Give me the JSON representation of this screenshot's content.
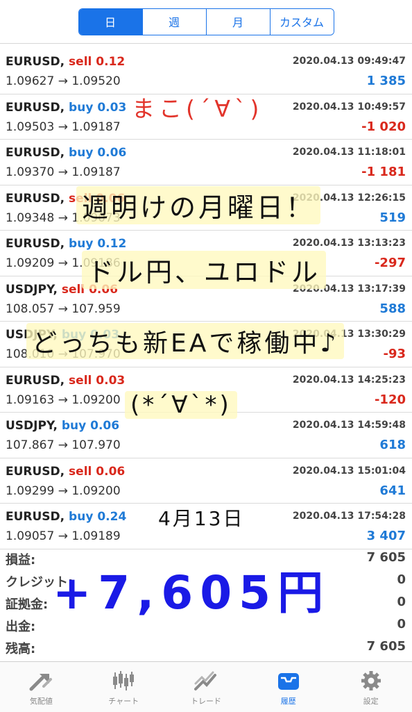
{
  "tabs_top": [
    "日",
    "週",
    "月",
    "カスタム"
  ],
  "deals": [
    {
      "symbol": "EURUSD,",
      "side": "sell",
      "volume": "0.12",
      "time": "2020.04.13 09:49:47",
      "prices": "1.09627 → 1.09520",
      "profit": "1 385",
      "sign": "pos"
    },
    {
      "symbol": "EURUSD,",
      "side": "buy",
      "volume": "0.03",
      "time": "2020.04.13 10:49:57",
      "prices": "1.09503 → 1.09187",
      "profit": "-1 020",
      "sign": "neg"
    },
    {
      "symbol": "EURUSD,",
      "side": "buy",
      "volume": "0.06",
      "time": "2020.04.13 11:18:01",
      "prices": "1.09370 → 1.09187",
      "profit": "-1 181",
      "sign": "neg"
    },
    {
      "symbol": "EURUSD,",
      "side": "sell",
      "volume": "0.06",
      "time": "2020.04.13 12:26:15",
      "prices": "1.09348 → 1.09073",
      "profit": "519",
      "sign": "pos"
    },
    {
      "symbol": "EURUSD,",
      "side": "buy",
      "volume": "0.12",
      "time": "2020.04.13 13:13:23",
      "prices": "1.09209 → 1.09186",
      "profit": "-297",
      "sign": "neg"
    },
    {
      "symbol": "USDJPY,",
      "side": "sell",
      "volume": "0.06",
      "time": "2020.04.13 13:17:39",
      "prices": "108.057 → 107.959",
      "profit": "588",
      "sign": "pos"
    },
    {
      "symbol": "USDJPY,",
      "side": "buy",
      "volume": "0.03",
      "time": "2020.04.13 13:30:29",
      "prices": "108.010 → 107.970",
      "profit": "-93",
      "sign": "neg"
    },
    {
      "symbol": "EURUSD,",
      "side": "sell",
      "volume": "0.03",
      "time": "2020.04.13 14:25:23",
      "prices": "1.09163 → 1.09200",
      "profit": "-120",
      "sign": "neg"
    },
    {
      "symbol": "USDJPY,",
      "side": "buy",
      "volume": "0.06",
      "time": "2020.04.13 14:59:48",
      "prices": "107.867 → 107.970",
      "profit": "618",
      "sign": "pos"
    },
    {
      "symbol": "EURUSD,",
      "side": "sell",
      "volume": "0.06",
      "time": "2020.04.13 15:01:04",
      "prices": "1.09299 → 1.09200",
      "profit": "641",
      "sign": "pos"
    },
    {
      "symbol": "EURUSD,",
      "side": "buy",
      "volume": "0.24",
      "time": "2020.04.13 17:54:28",
      "prices": "1.09057 → 1.09189",
      "profit": "3 407",
      "sign": "pos"
    }
  ],
  "summary": [
    {
      "label": "損益:",
      "value": "7 605"
    },
    {
      "label": "クレジット:",
      "value": "0"
    },
    {
      "label": "証拠金:",
      "value": "0"
    },
    {
      "label": "出金:",
      "value": "0"
    },
    {
      "label": "残高:",
      "value": "7 605"
    }
  ],
  "tabbar": [
    {
      "label": "気配値",
      "icon": "quotes-icon",
      "active": false
    },
    {
      "label": "チャート",
      "icon": "chart-icon",
      "active": false
    },
    {
      "label": "トレード",
      "icon": "trade-icon",
      "active": false
    },
    {
      "label": "履歴",
      "icon": "history-icon",
      "active": true
    },
    {
      "label": "設定",
      "icon": "settings-icon",
      "active": false
    }
  ],
  "overlay": {
    "red_note": "まこ(´∀`)",
    "line1": "週明けの月曜日！",
    "line2": "ドル円、ユロドル",
    "line3": "どっちも新EAで稼働中♪",
    "line4": "(*´∀`*)",
    "date": "4月13日",
    "total": "+7,605円"
  },
  "colors": {
    "accent": "#1a73e8",
    "sell": "#d9281c",
    "buy": "#1f7ad6",
    "profit_pos": "#1f7ad6",
    "profit_neg": "#d9281c"
  }
}
